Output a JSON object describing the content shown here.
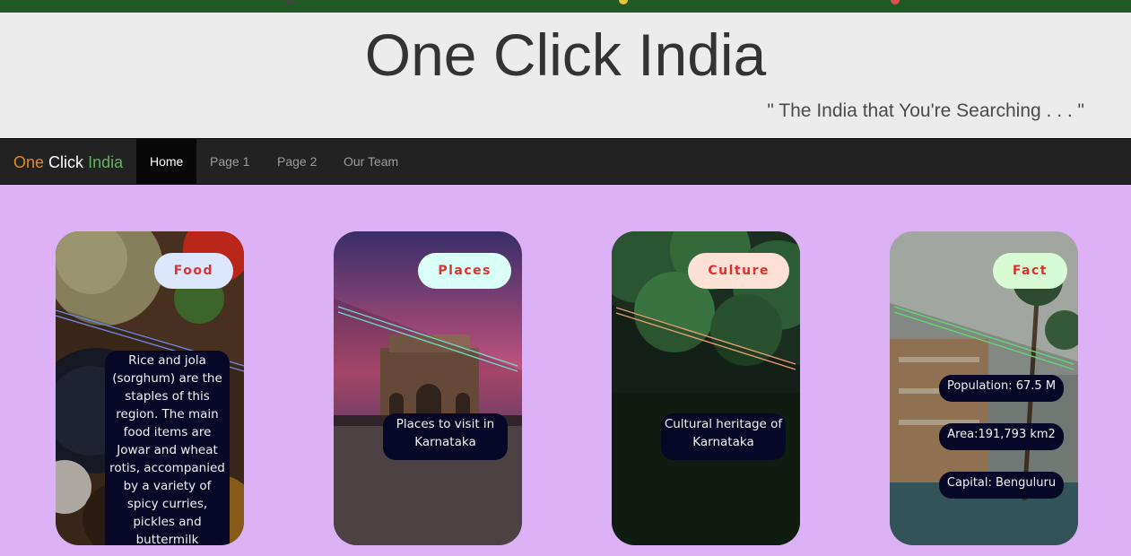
{
  "hero": {
    "title": "One Click India",
    "tagline": "\" The India that You're Searching . . . \""
  },
  "navbar": {
    "brand": [
      "One",
      "Click",
      "India"
    ],
    "items": [
      {
        "label": "Home",
        "active": true
      },
      {
        "label": "Page 1",
        "active": false
      },
      {
        "label": "Page 2",
        "active": false
      },
      {
        "label": "Our Team",
        "active": false
      }
    ]
  },
  "cards": [
    {
      "tag": "Food",
      "tag_bg": "#dce6ff",
      "text": "Rice and jola (sorghum) are the staples of this region. The main food items are Jowar and wheat rotis, accompanied by a variety of spicy curries, pickles and buttermilk"
    },
    {
      "tag": "Places",
      "tag_bg": "#d9fff7",
      "text": "Places to visit in Karnataka"
    },
    {
      "tag": "Culture",
      "tag_bg": "#fde1d4",
      "text": "Cultural heritage of Karnataka"
    },
    {
      "tag": "Fact",
      "tag_bg": "#d7fcd4",
      "facts": [
        "Population: 67.5 M",
        "Area:191,793 km2",
        "Capital: Benguluru"
      ]
    }
  ],
  "colors": {
    "page_bg": "#dcb1f5",
    "top_strip": "#1f5a25",
    "navbar_bg": "#222222",
    "tag_text": "#d9322f",
    "caption_bg": "#070828"
  }
}
